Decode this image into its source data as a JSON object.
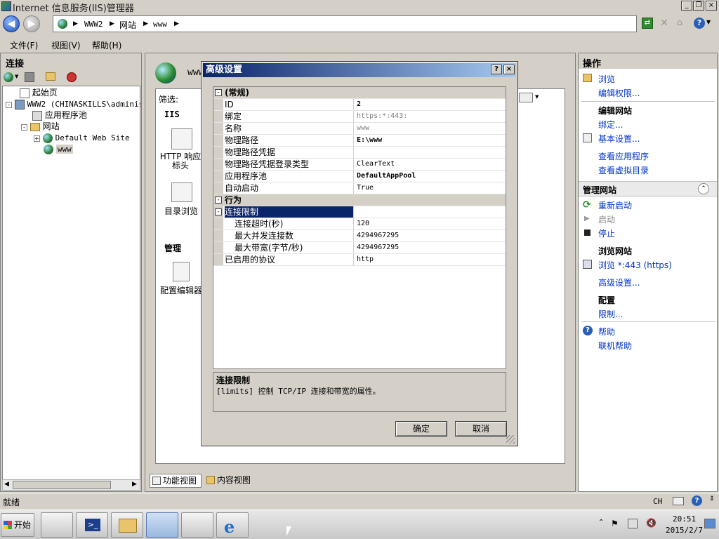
{
  "window": {
    "title": "Internet 信息服务(IIS)管理器"
  },
  "address": {
    "crumbs": [
      "WWW2",
      "网站",
      "www"
    ]
  },
  "menu": {
    "file": "文件(F)",
    "view": "视图(V)",
    "help": "帮助(H)"
  },
  "connections": {
    "header": "连接",
    "tree": [
      "起始页",
      "WWW2 (CHINASKILLS\\administ",
      "应用程序池",
      "网站",
      "Default Web Site",
      "www"
    ]
  },
  "center": {
    "title": "www",
    "filter_label": "筛选:",
    "section_iis": "IIS",
    "http_headers": "HTTP 响应标头",
    "dir_browse": "目录浏览",
    "section_manage": "管理",
    "config_editor": "配置编辑器",
    "feature_view": "功能视图",
    "content_view": "内容视图"
  },
  "dialog": {
    "title": "高级设置",
    "help_btn": "?",
    "close_btn": "×",
    "cat_general": "(常规)",
    "rows_general": [
      {
        "k": "ID",
        "v": "2",
        "bold": true
      },
      {
        "k": "绑定",
        "v": "https:*:443:",
        "gray": true
      },
      {
        "k": "名称",
        "v": "www",
        "gray": true
      },
      {
        "k": "物理路径",
        "v": "E:\\www",
        "bold": true
      },
      {
        "k": "物理路径凭据",
        "v": ""
      },
      {
        "k": "物理路径凭据登录类型",
        "v": "ClearText"
      },
      {
        "k": "应用程序池",
        "v": "DefaultAppPool",
        "bold": true
      },
      {
        "k": "自动启动",
        "v": "True"
      }
    ],
    "cat_behavior": "行为",
    "limits_label": "连接限制",
    "rows_limits": [
      {
        "k": "连接超时(秒)",
        "v": "120"
      },
      {
        "k": "最大并发连接数",
        "v": "4294967295"
      },
      {
        "k": "最大带宽(字节/秒)",
        "v": "4294967295"
      }
    ],
    "protocols": {
      "k": "已启用的协议",
      "v": "http"
    },
    "desc_title": "连接限制",
    "desc_text": "[limits] 控制 TCP/IP 连接和带宽的属性。",
    "ok": "确定",
    "cancel": "取消"
  },
  "actions": {
    "header": "操作",
    "browse": "浏览",
    "edit_perms": "编辑权限...",
    "edit_site_head": "编辑网站",
    "bindings": "绑定...",
    "basic_settings": "基本设置...",
    "view_apps": "查看应用程序",
    "view_vdirs": "查看虚拟目录",
    "manage_head": "管理网站",
    "restart": "重新启动",
    "start": "启动",
    "stop": "停止",
    "browse_site_head": "浏览网站",
    "browse_https": "浏览 *:443 (https)",
    "advanced": "高级设置...",
    "config_head": "配置",
    "limits": "限制...",
    "help": "帮助",
    "online_help": "联机帮助"
  },
  "status": {
    "text": "就绪",
    "lang": "CH"
  },
  "taskbar": {
    "start": "开始",
    "time": "20:51",
    "date": "2015/2/7"
  }
}
